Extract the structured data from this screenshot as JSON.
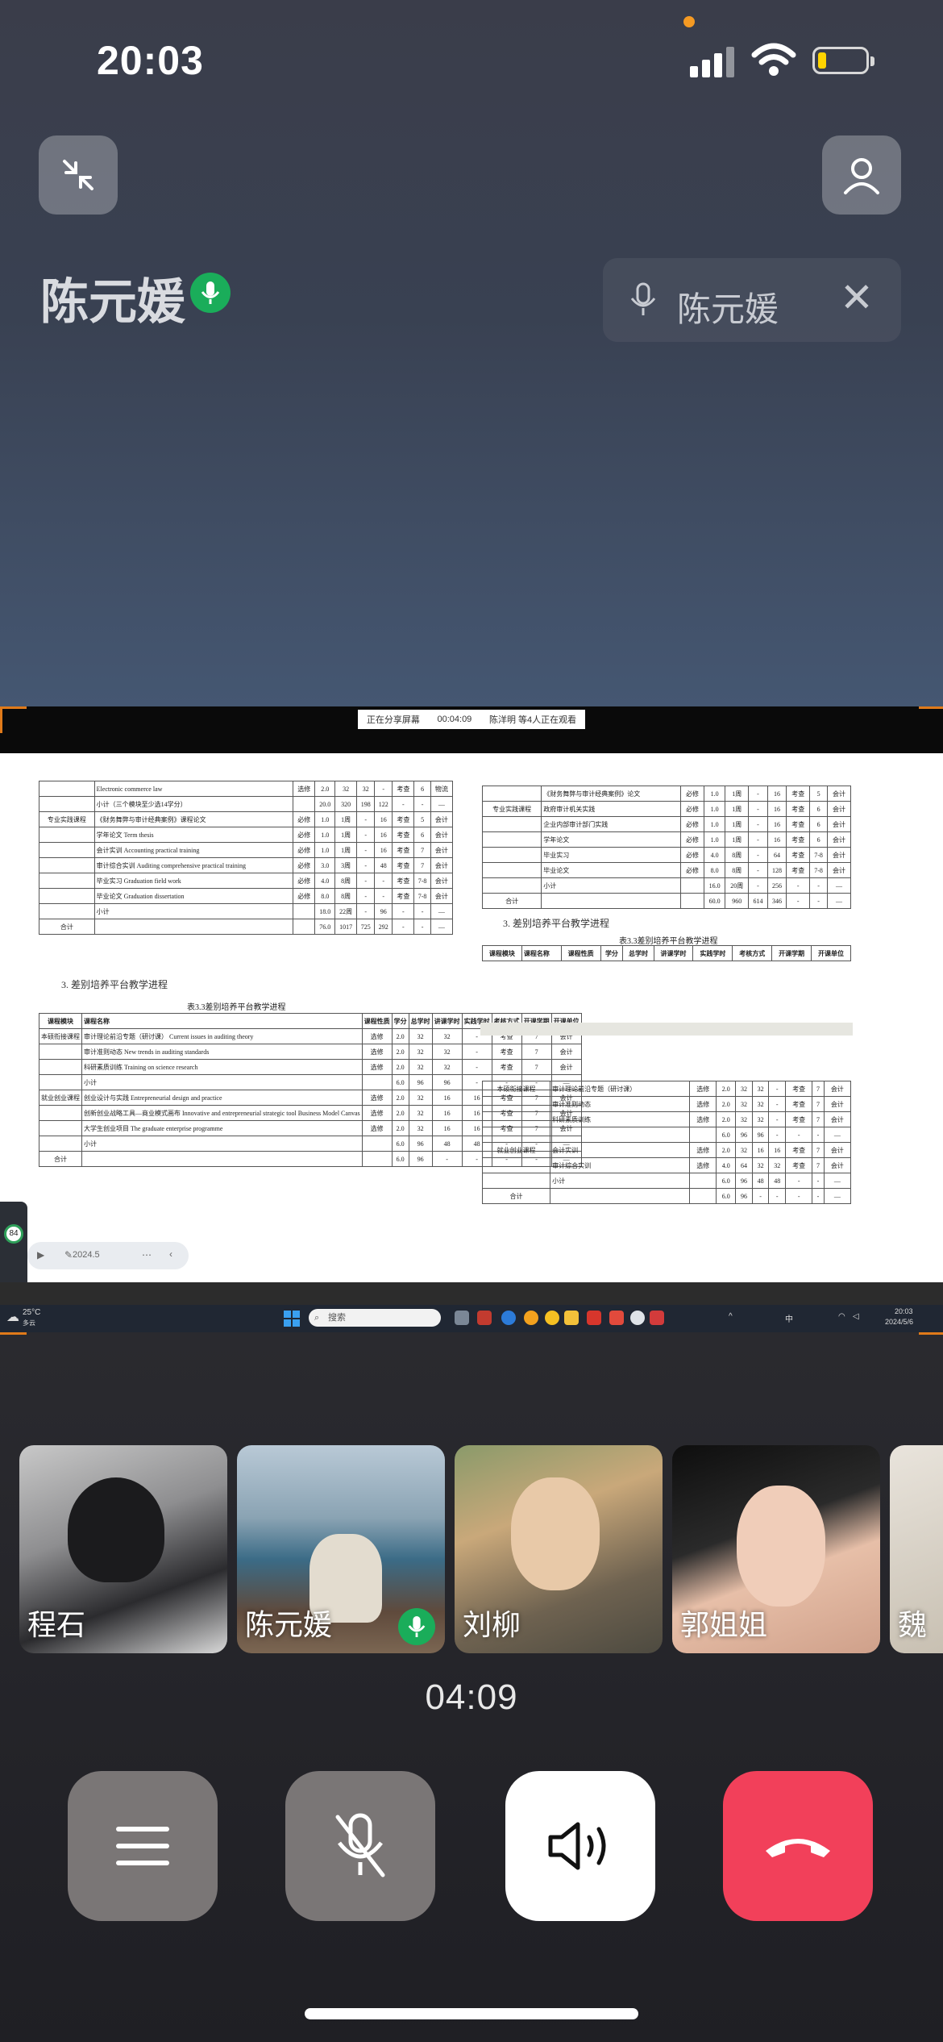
{
  "status": {
    "time": "20:03"
  },
  "call": {
    "speaker_name": "陈元媛",
    "pinned_chip_label": "陈元媛",
    "duration": "04:09"
  },
  "share": {
    "banner_status": "正在分享屏幕",
    "banner_time": "00:04:09",
    "banner_viewers": "陈洋明 等4人正在观看",
    "taskbar": {
      "weather_temp": "25°C",
      "weather_text": "多云",
      "search_placeholder": "搜索",
      "clock_time": "20:03",
      "clock_date": "2024/5/6",
      "ime": "中"
    },
    "doc": {
      "left_top_rows": [
        [
          "",
          "Electronic commerce law",
          "选修",
          "2.0",
          "32",
          "32",
          "-",
          "考查",
          "6",
          "物流"
        ],
        [
          "",
          "小计（三个模块至少选14学分）",
          "",
          "20.0",
          "320",
          "198",
          "122",
          "-",
          "-",
          "—"
        ],
        [
          "专业实践课程",
          "《财务舞弊与审计经典案例》课程论文",
          "必修",
          "1.0",
          "1周",
          "-",
          "16",
          "考查",
          "5",
          "会计"
        ],
        [
          "",
          "学年论文 Term thesis",
          "必修",
          "1.0",
          "1周",
          "-",
          "16",
          "考查",
          "6",
          "会计"
        ],
        [
          "",
          "会计实训 Accounting practical training",
          "必修",
          "1.0",
          "1周",
          "-",
          "16",
          "考查",
          "7",
          "会计"
        ],
        [
          "",
          "审计综合实训 Auditing comprehensive practical training",
          "必修",
          "3.0",
          "3周",
          "-",
          "48",
          "考查",
          "7",
          "会计"
        ],
        [
          "",
          "毕业实习 Graduation field work",
          "必修",
          "4.0",
          "8周",
          "-",
          "-",
          "考查",
          "7-8",
          "会计"
        ],
        [
          "",
          "毕业论文 Graduation dissertation",
          "必修",
          "8.0",
          "8周",
          "-",
          "-",
          "考查",
          "7-8",
          "会计"
        ],
        [
          "",
          "小计",
          "",
          "18.0",
          "22周",
          "-",
          "96",
          "-",
          "-",
          "—"
        ],
        [
          "合计",
          "",
          "",
          "76.0",
          "1017",
          "725",
          "292",
          "-",
          "-",
          "—"
        ]
      ],
      "left_heading": "3. 差别培养平台教学进程",
      "left_caption": "表3.3差别培养平台教学进程",
      "left_header": [
        "课程模块",
        "课程名称",
        "课程性质",
        "学分",
        "总学时",
        "讲课学时",
        "实践学时",
        "考核方式",
        "开课学期",
        "开课单位"
      ],
      "left_bottom_rows": [
        [
          "本硕衔接课程",
          "审计理论前沿专题（研讨课） Current issues in auditing theory",
          "选修",
          "2.0",
          "32",
          "32",
          "-",
          "考查",
          "7",
          "会计"
        ],
        [
          "",
          "审计准则动态 New trends in auditing standards",
          "选修",
          "2.0",
          "32",
          "32",
          "-",
          "考查",
          "7",
          "会计"
        ],
        [
          "",
          "科研素质训练 Training on science research",
          "选修",
          "2.0",
          "32",
          "32",
          "-",
          "考查",
          "7",
          "会计"
        ],
        [
          "",
          "小计",
          "",
          "6.0",
          "96",
          "96",
          "-",
          "-",
          "-",
          "—"
        ],
        [
          "就业创业课程",
          "创业设计与实践 Entrepreneurial design and practice",
          "选修",
          "2.0",
          "32",
          "16",
          "16",
          "考查",
          "7",
          "会计"
        ],
        [
          "",
          "创新创业战略工具—商业模式画布 Innovative and entrepreneurial strategic tool Business Model Canvas",
          "选修",
          "2.0",
          "32",
          "16",
          "16",
          "考查",
          "7",
          "会计"
        ],
        [
          "",
          "大学生创业项目 The graduate enterprise programme",
          "选修",
          "2.0",
          "32",
          "16",
          "16",
          "考查",
          "7",
          "会计"
        ],
        [
          "",
          "小计",
          "",
          "6.0",
          "96",
          "48",
          "48",
          "-",
          "-",
          "—"
        ],
        [
          "合计",
          "",
          "",
          "6.0",
          "96",
          "-",
          "-",
          "-",
          "-",
          "—"
        ]
      ],
      "right_top_rows": [
        [
          "",
          "《财务舞弊与审计经典案例》论文",
          "必修",
          "1.0",
          "1周",
          "-",
          "16",
          "考查",
          "5",
          "会计"
        ],
        [
          "专业实践课程",
          "政府审计机关实践",
          "必修",
          "1.0",
          "1周",
          "-",
          "16",
          "考查",
          "6",
          "会计"
        ],
        [
          "",
          "企业内部审计部门实践",
          "必修",
          "1.0",
          "1周",
          "-",
          "16",
          "考查",
          "6",
          "会计"
        ],
        [
          "",
          "学年论文",
          "必修",
          "1.0",
          "1周",
          "-",
          "16",
          "考查",
          "6",
          "会计"
        ],
        [
          "",
          "毕业实习",
          "必修",
          "4.0",
          "8周",
          "-",
          "64",
          "考查",
          "7-8",
          "会计"
        ],
        [
          "",
          "毕业论文",
          "必修",
          "8.0",
          "8周",
          "-",
          "128",
          "考查",
          "7-8",
          "会计"
        ],
        [
          "",
          "小计",
          "",
          "16.0",
          "20周",
          "-",
          "256",
          "-",
          "-",
          "—"
        ],
        [
          "合计",
          "",
          "",
          "60.0",
          "960",
          "614",
          "346",
          "-",
          "-",
          "—"
        ]
      ],
      "right_heading": "3. 差别培养平台教学进程",
      "right_caption": "表3.3差别培养平台教学进程",
      "right_bottom_rows": [
        [
          "本硕衔接课程",
          "审计理论前沿专题（研讨课）",
          "选修",
          "2.0",
          "32",
          "32",
          "-",
          "考查",
          "7",
          "会计"
        ],
        [
          "",
          "审计准则动态",
          "选修",
          "2.0",
          "32",
          "32",
          "-",
          "考查",
          "7",
          "会计"
        ],
        [
          "",
          "科研素质训练",
          "选修",
          "2.0",
          "32",
          "32",
          "-",
          "考查",
          "7",
          "会计"
        ],
        [
          "",
          "",
          "",
          "6.0",
          "96",
          "96",
          "-",
          "-",
          "-",
          "—"
        ],
        [
          "就业创业课程",
          "会计实训",
          "选修",
          "2.0",
          "32",
          "16",
          "16",
          "考查",
          "7",
          "会计"
        ],
        [
          "",
          "审计综合实训",
          "选修",
          "4.0",
          "64",
          "32",
          "32",
          "考查",
          "7",
          "会计"
        ],
        [
          "",
          "小计",
          "",
          "6.0",
          "96",
          "48",
          "48",
          "-",
          "-",
          "—"
        ],
        [
          "合计",
          "",
          "",
          "6.0",
          "96",
          "-",
          "-",
          "-",
          "-",
          "—"
        ]
      ],
      "side_widget_value": "84",
      "float_toolbar_text": "2024.5"
    }
  },
  "participants": [
    {
      "name": "程石",
      "speaking": false
    },
    {
      "name": "陈元媛",
      "speaking": true
    },
    {
      "name": "刘柳",
      "speaking": false
    },
    {
      "name": "郭姐姐",
      "speaking": false
    },
    {
      "name": "魏",
      "speaking": false
    }
  ],
  "controls": [
    {
      "id": "menu",
      "icon": "menu-icon"
    },
    {
      "id": "mute",
      "icon": "mic-off-icon"
    },
    {
      "id": "speaker",
      "icon": "speaker-icon"
    },
    {
      "id": "hangup",
      "icon": "hang-up-icon"
    }
  ],
  "colors": {
    "accent_green": "#1aad5a",
    "hangup_red": "#f2405a",
    "orange_dot": "#f59a23"
  }
}
